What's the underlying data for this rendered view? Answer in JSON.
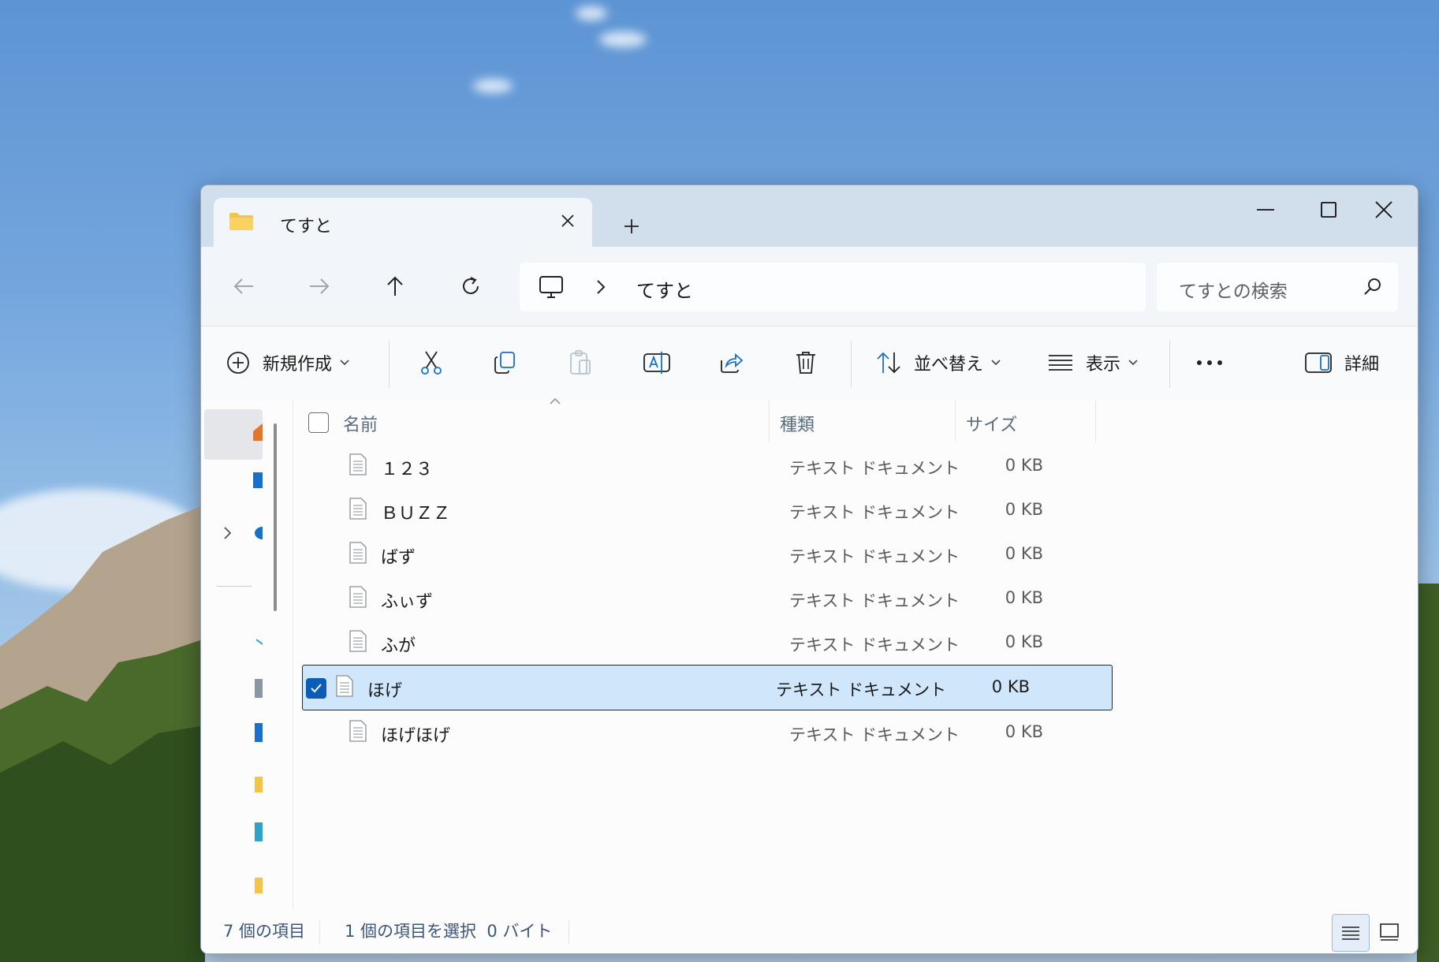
{
  "window": {
    "tab_title": "てすと",
    "address_segment": "てすと",
    "search_placeholder": "てすとの検索"
  },
  "toolbar": {
    "new_label": "新規作成",
    "sort_label": "並べ替え",
    "view_label": "表示",
    "details_label": "詳細"
  },
  "columns": {
    "name": "名前",
    "type": "種類",
    "size": "サイズ"
  },
  "files": [
    {
      "name": "１２３",
      "type": "テキスト ドキュメント",
      "size": "0 KB",
      "selected": false
    },
    {
      "name": "ＢＵＺＺ",
      "type": "テキスト ドキュメント",
      "size": "0 KB",
      "selected": false
    },
    {
      "name": "ばず",
      "type": "テキスト ドキュメント",
      "size": "0 KB",
      "selected": false
    },
    {
      "name": "ふぃず",
      "type": "テキスト ドキュメント",
      "size": "0 KB",
      "selected": false
    },
    {
      "name": "ふが",
      "type": "テキスト ドキュメント",
      "size": "0 KB",
      "selected": false
    },
    {
      "name": "ほげ",
      "type": "テキスト ドキュメント",
      "size": "0 KB",
      "selected": true
    },
    {
      "name": "ほげほげ",
      "type": "テキスト ドキュメント",
      "size": "0 KB",
      "selected": false
    }
  ],
  "status": {
    "item_count": "7 個の項目",
    "selection": "1 個の項目を選択  0 バイト"
  },
  "icons": {
    "back": "arrow-left-icon",
    "forward": "arrow-right-icon",
    "up": "arrow-up-icon",
    "refresh": "refresh-icon",
    "pc": "monitor-icon",
    "search": "search-icon",
    "cut": "scissors-icon",
    "copy": "copy-icon",
    "paste": "paste-icon",
    "rename": "rename-icon",
    "share": "share-icon",
    "delete": "trash-icon",
    "more": "more-icon"
  },
  "colors": {
    "accent": "#0b5cb5",
    "selection_bg": "#cfe6fb",
    "titlebar": "#d1deec"
  }
}
